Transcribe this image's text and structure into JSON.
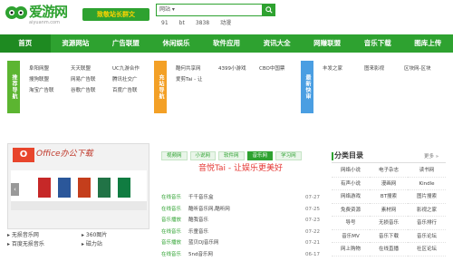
{
  "header": {
    "logo_text": "爱游网",
    "logo_sub": "aiyuanm.com",
    "slogan": "致敬站长群文",
    "search_category": "网站 ▾",
    "hot_words": [
      "91",
      "bt",
      "3838",
      "动漫"
    ]
  },
  "nav": [
    "首页",
    "资源网站",
    "广告联盟",
    "休闲娱乐",
    "软件应用",
    "资讯大全",
    "网赚联盟",
    "音乐下载",
    "图库上传"
  ],
  "ads": {
    "tag_green": "推荐导航",
    "tag_orange": "充站导航",
    "tag_blue": "最新快审",
    "col1": [
      "阜阳网盟",
      "搜狗联盟",
      "淘宝广告联"
    ],
    "col2": [
      "天天联盟",
      "网易广告联",
      "谷歌广告联"
    ],
    "col3": [
      "UC九游合作",
      "腾讯社交广",
      "百度广告联"
    ],
    "col4": [
      "酷何共享网",
      "爱剪Tai - 让"
    ],
    "col5": [
      "4399小游戏"
    ],
    "col6": [
      "CBO中国票"
    ],
    "col7": [
      "丰发之家"
    ],
    "col8": [
      "图来影视"
    ],
    "col9": [
      "区块网-区块"
    ]
  },
  "left": {
    "office_logo": "O",
    "office_word": "Office办公下载",
    "list1": [
      "无损音乐网",
      "百度无损音乐"
    ],
    "list2": [
      "360图片",
      "磁力站"
    ]
  },
  "middle": {
    "tabs": [
      "视频网",
      "小说网",
      "软件网",
      "音乐网",
      "学习网"
    ],
    "active_tab": 3,
    "title": "音悦Tai - 让娱乐更美好",
    "rows": [
      {
        "c": "在线音乐",
        "t": "千千音乐盒",
        "d": "07-27"
      },
      {
        "c": "在线音乐",
        "t": "酷听音乐网,酷听网",
        "d": "07-25"
      },
      {
        "c": "音乐播放",
        "t": "酷我音乐",
        "d": "07-23"
      },
      {
        "c": "在线音乐",
        "t": "乐童音乐",
        "d": "07-22"
      },
      {
        "c": "音乐播放",
        "t": "蓝贝DJ音乐网",
        "d": "07-21"
      },
      {
        "c": "在线音乐",
        "t": "5nd音乐网",
        "d": "06-17"
      }
    ]
  },
  "right": {
    "title": "分类目录",
    "more": "更多 »",
    "cells": [
      "网络小说",
      "电子杂志",
      "读书网",
      "有声小说",
      "漫画网",
      "Kindle",
      "网络游戏",
      "BT搜索",
      "图片搜索",
      "免费资源",
      "素材网",
      "影视之家",
      "导号",
      "无损音乐",
      "音乐排行",
      "音乐MV",
      "音乐下载",
      "音乐论坛",
      "网上购物",
      "在线直播",
      "社区论坛"
    ]
  }
}
